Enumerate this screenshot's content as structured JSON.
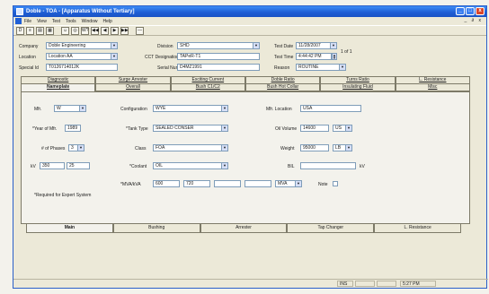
{
  "window": {
    "title": "Doble - TOA - [Apparatus Without Tertiary]",
    "min": "_",
    "max": "□",
    "close": "x"
  },
  "menu": [
    "File",
    "View",
    "Test",
    "Tools",
    "Window",
    "Help"
  ],
  "menu_right": "_ ∂ x",
  "toolbar": [
    "D",
    "≡",
    "▤",
    "▦",
    "☺",
    "◎",
    "W?",
    "◀◀",
    "◀",
    "▶",
    "▶▶",
    "—"
  ],
  "header": {
    "company_label": "Company",
    "company_value": "Doble Engineering",
    "division_label": "Division",
    "division_value": "SHD",
    "test_date_label": "Test Date",
    "test_date_value": "11/28/2007",
    "location_label": "Location",
    "location_value": "Location AA",
    "cct_label": "CCT Designation",
    "cct_value": "TAPeR-T1",
    "test_time_label": "Test Time",
    "test_time_value": "4:44:42 PM",
    "test_side": "1 of 1",
    "special_id_label": "Special Id",
    "special_id_value": "T0126714012K",
    "serial_label": "Serial Num",
    "serial_value": "D4MZ1991",
    "reason_label": "Reason",
    "reason_value": "ROUTINE"
  },
  "tabs_row1": [
    "Diagnostic",
    "Surge Arrester",
    "Exciting Current",
    "Doble Ratio",
    "Turns Ratio",
    "L. Resistance"
  ],
  "tabs_row2": [
    "Nameplate",
    "Overall",
    "Bush C1/C2",
    "Bush Hot Collar",
    "Insulating Fluid",
    "Misc"
  ],
  "nameplate": {
    "mfr_label": "Mfr.",
    "mfr_value": "W",
    "config_label": "Configuration",
    "config_value": "WYE",
    "mfr_loc_label": "Mfr. Location",
    "mfr_loc_value": "USA",
    "year_label": "*Year of Mfr.",
    "year_value": "1989",
    "tank_label": "*Tank Type",
    "tank_value": "SEALED CONSER",
    "oil_vol_label": "Oil Volume",
    "oil_vol_value": "14600",
    "oil_vol_unit": "US",
    "phases_label": "# of Phases",
    "phases_value": "3",
    "class_label": "Class",
    "class_value": "FOA",
    "weight_label": "Weight",
    "weight_value": "95000",
    "weight_unit": "LB",
    "kv_label": "kV",
    "kv_value1": "350",
    "kv_value2": "25",
    "coolant_label": "*Coolant",
    "coolant_value": "OIL",
    "bil_label": "BIL",
    "bil_unit": "kV",
    "mva_label": "*MVA/kVA",
    "mva_value1": "600",
    "mva_value2": "720",
    "mva_unit": "MVA",
    "note_label": "Note",
    "required_note": "*Required for Expert System"
  },
  "bottom_tabs": [
    "Main",
    "Bushing",
    "Arrester",
    "Tap Changer",
    "L. Resistance"
  ],
  "status": {
    "cell1": "INS",
    "cell2": "",
    "cell3": "",
    "time": "5:27 PM"
  }
}
